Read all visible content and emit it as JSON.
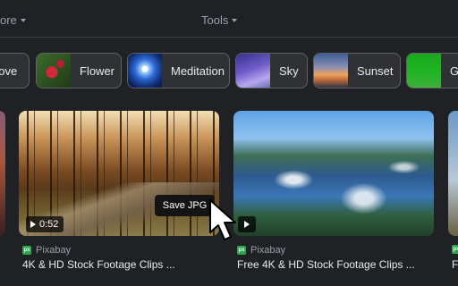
{
  "top_menu": {
    "more_label": "ore",
    "tools_label": "Tools"
  },
  "chips": [
    {
      "label": "Love"
    },
    {
      "label": "Flower"
    },
    {
      "label": "Meditation"
    },
    {
      "label": "Sky"
    },
    {
      "label": "Sunset"
    },
    {
      "label": "G"
    }
  ],
  "cards": [
    {
      "source": "Pixabay",
      "title": "4K & HD Stock Footage Clips ...",
      "duration": "0:52"
    },
    {
      "source": "Pixabay",
      "title": "Free 4K & HD Stock Footage Clips ..."
    },
    {
      "source": "",
      "title": "F"
    }
  ],
  "tooltip": {
    "label": "Save JPG"
  },
  "icons": {
    "source_icon": "pixabay-icon",
    "cursor": "pointer-cursor-icon"
  },
  "colors": {
    "background": "#202124",
    "source_badge": "#2ea44f",
    "chip_border": "#5f6368"
  }
}
